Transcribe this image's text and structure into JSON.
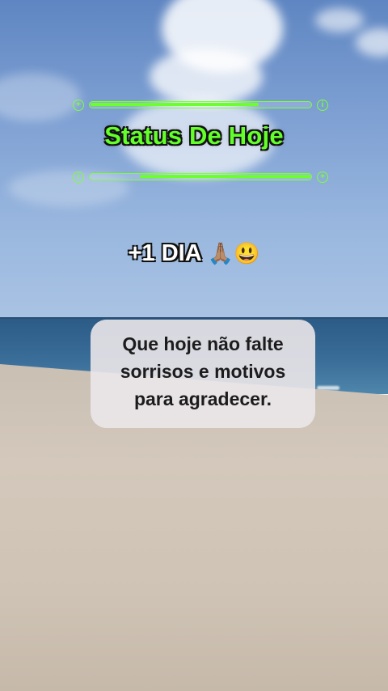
{
  "status": {
    "title": "Status De Hoje",
    "bar_top": {
      "fill_fraction": 0.77,
      "left_icon": "plus-circle-icon",
      "right_icon": "info-circle-icon"
    },
    "bar_bottom": {
      "fill_fraction": 0.78,
      "left_icon": "info-circle-icon",
      "right_icon": "plus-circle-icon"
    },
    "accent_color": "#62ff2a"
  },
  "day": {
    "label": "+1 DIA",
    "emoji_1": "🙏🏽",
    "emoji_2": "😃"
  },
  "message": {
    "line1": "Que hoje não falte",
    "line2": "sorrisos e motivos",
    "line3": "para agradecer."
  }
}
